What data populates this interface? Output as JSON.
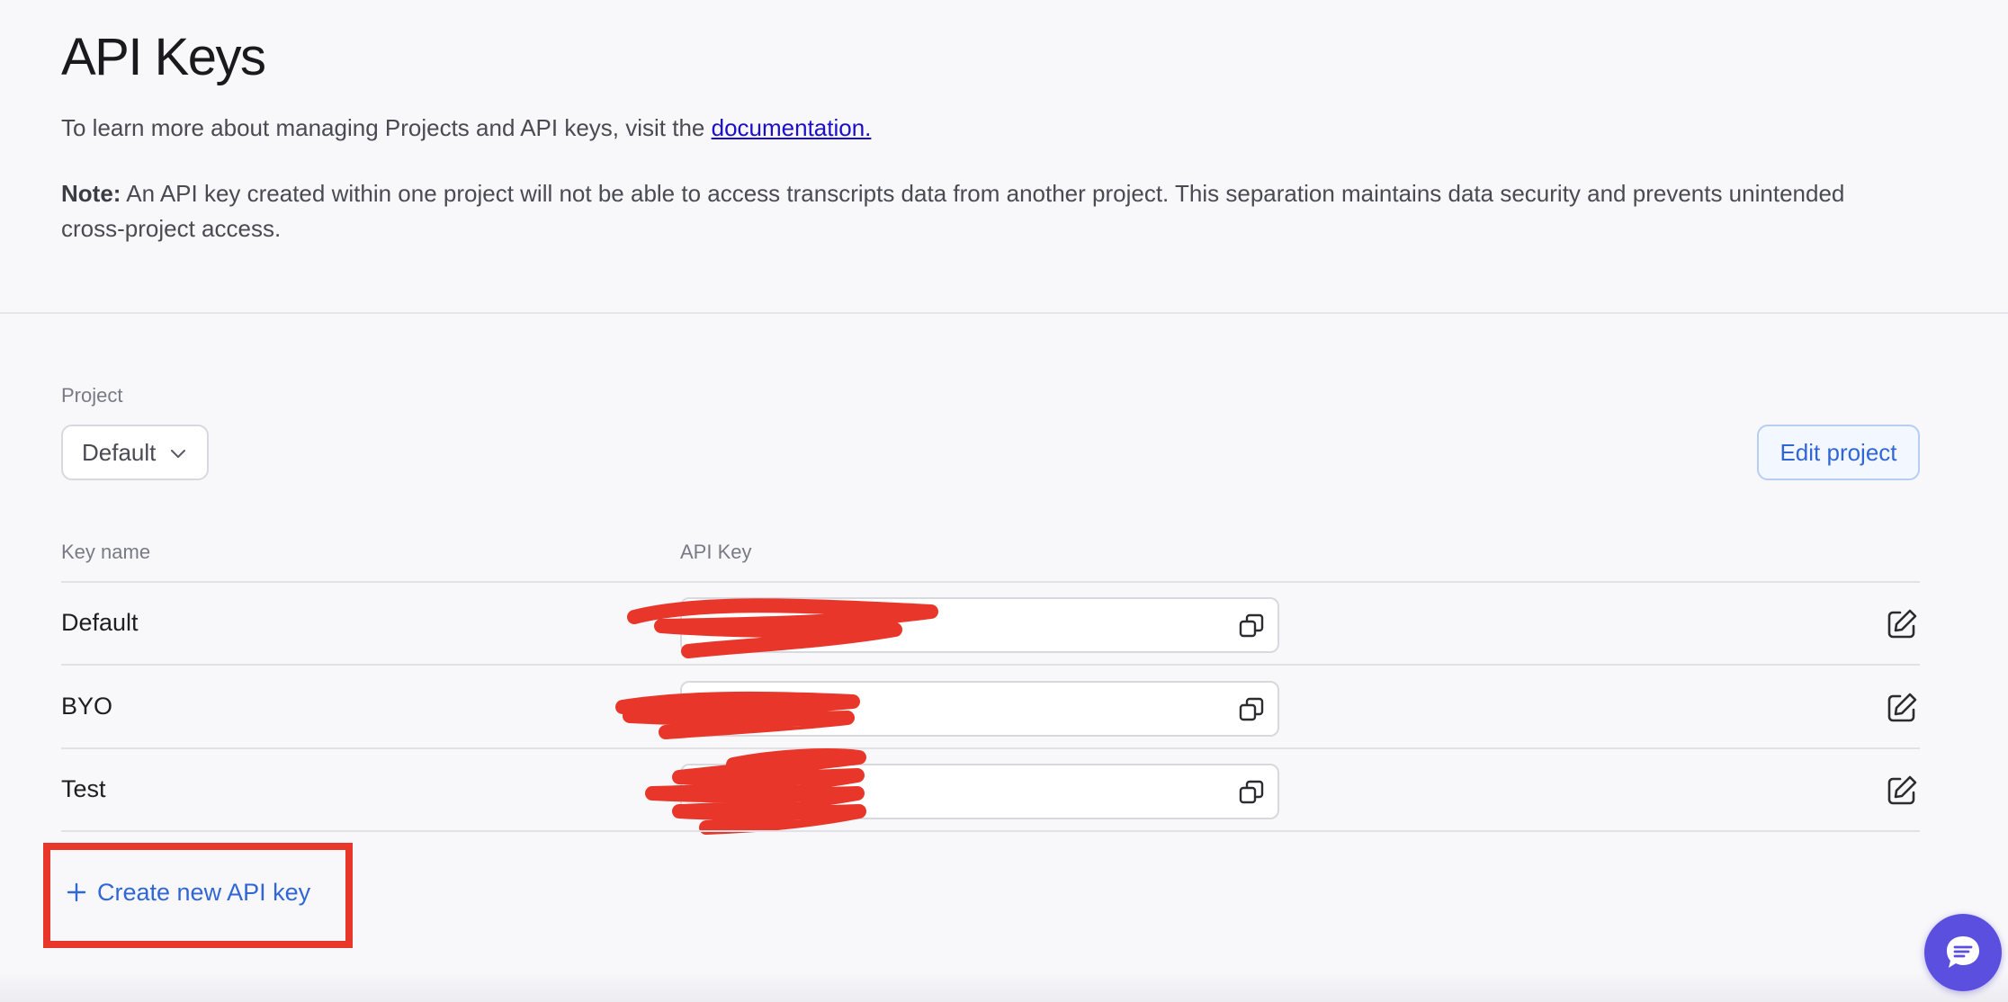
{
  "header": {
    "title": "API Keys",
    "intro_text": "To learn more about managing Projects and API keys, visit the ",
    "intro_link": "documentation.",
    "note_label": "Note:",
    "note_text": " An API key created within one project will not be able to access transcripts data from another project. This separation maintains data security and prevents unintended cross-project access."
  },
  "project": {
    "label": "Project",
    "selected": "Default",
    "edit_label": "Edit project"
  },
  "table": {
    "col_key_name": "Key name",
    "col_api_key": "API Key",
    "rows": [
      {
        "name": "Default"
      },
      {
        "name": "BYO"
      },
      {
        "name": "Test"
      }
    ]
  },
  "actions": {
    "create_label": "Create new API key"
  },
  "colors": {
    "accent_blue": "#3166d6",
    "link": "#1a0dcc",
    "highlight_red": "#e8372a",
    "chat_purple": "#5b4fe0"
  },
  "icons": {
    "copy": "copy-icon",
    "edit": "edit-icon",
    "chevron": "chevron-down-icon",
    "plus": "plus-icon",
    "chat": "chat-icon"
  }
}
